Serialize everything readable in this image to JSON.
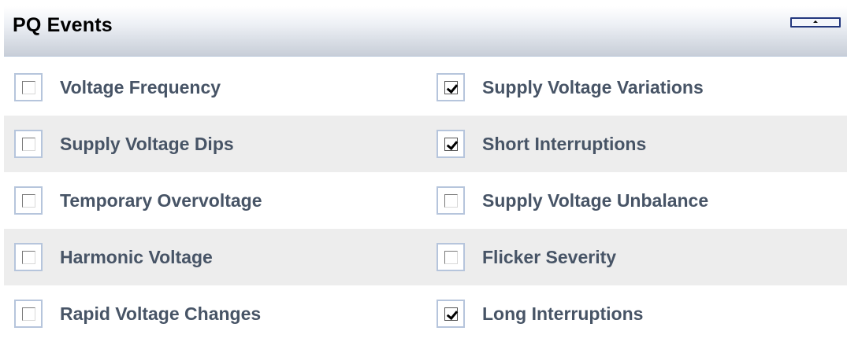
{
  "panel": {
    "title": "PQ Events",
    "collapse_icon": "chevron-up-icon"
  },
  "rows": [
    {
      "left": {
        "label": "Voltage Frequency",
        "checked": false
      },
      "right": {
        "label": "Supply Voltage Variations",
        "checked": true
      }
    },
    {
      "left": {
        "label": "Supply Voltage Dips",
        "checked": false
      },
      "right": {
        "label": "Short Interruptions",
        "checked": true
      }
    },
    {
      "left": {
        "label": "Temporary Overvoltage",
        "checked": false
      },
      "right": {
        "label": "Supply Voltage Unbalance",
        "checked": false
      }
    },
    {
      "left": {
        "label": "Harmonic Voltage",
        "checked": false
      },
      "right": {
        "label": "Flicker Severity",
        "checked": false
      }
    },
    {
      "left": {
        "label": "Rapid Voltage Changes",
        "checked": false
      },
      "right": {
        "label": "Long Interruptions",
        "checked": true
      }
    }
  ],
  "colors": {
    "label_text": "#475466",
    "alt_row_bg": "#ededed",
    "checkbox_border": "#b6c5dc",
    "button_border": "#24387e"
  }
}
